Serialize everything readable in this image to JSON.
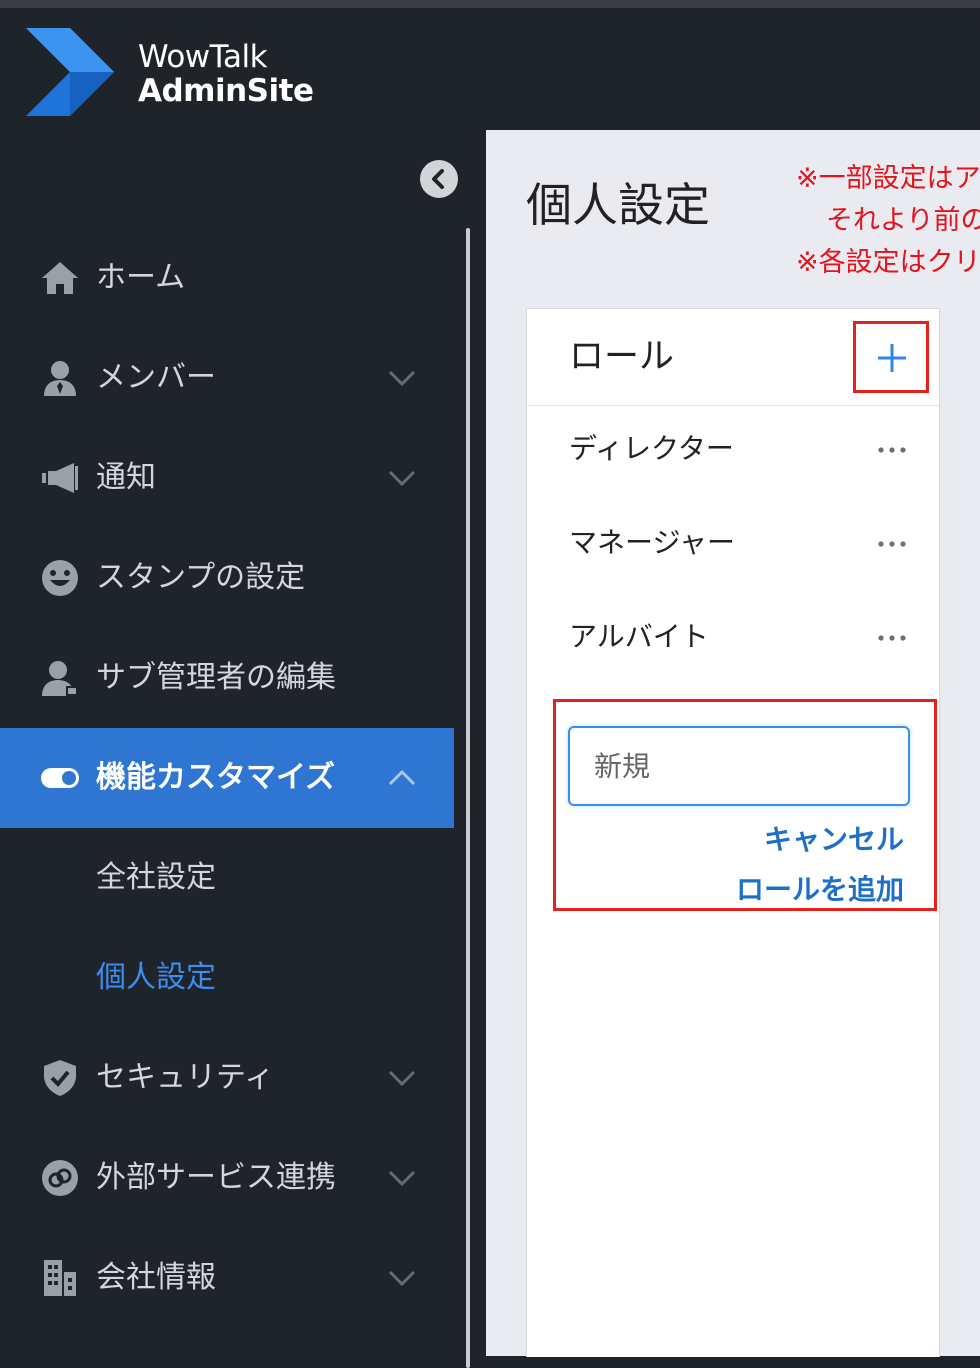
{
  "app": {
    "logo_line1": "WowTalk",
    "logo_line2": "AdminSite"
  },
  "colors": {
    "sidebar_bg": "#1f232a",
    "active_bg": "#2e76d2",
    "accent": "#3a8ef0",
    "highlight_red": "#e3221b",
    "notice_red": "#e6121c"
  },
  "sidebar": {
    "items": [
      {
        "label": "ホーム",
        "icon": "home-icon"
      },
      {
        "label": "メンバー",
        "icon": "member-icon",
        "expandable": true
      },
      {
        "label": "通知",
        "icon": "megaphone-icon",
        "expandable": true
      },
      {
        "label": "スタンプの設定",
        "icon": "smiley-icon"
      },
      {
        "label": "サブ管理者の編集",
        "icon": "sub-admin-icon"
      },
      {
        "label": "機能カスタマイズ",
        "icon": "toggle-icon",
        "expandable": true,
        "expanded": true,
        "active": true
      },
      {
        "label": "セキュリティ",
        "icon": "shield-icon",
        "expandable": true
      },
      {
        "label": "外部サービス連携",
        "icon": "link-icon",
        "expandable": true
      },
      {
        "label": "会社情報",
        "icon": "building-icon",
        "expandable": true
      }
    ],
    "subitems": [
      {
        "label": "全社設定"
      },
      {
        "label": "個人設定",
        "current": true
      }
    ]
  },
  "main": {
    "title": "個人設定",
    "notice_lines": [
      "※一部設定はア",
      "それより前の",
      "※各設定はクリ"
    ],
    "roles_panel": {
      "title": "ロール",
      "roles": [
        "ディレクター",
        "マネージャー",
        "アルバイト"
      ],
      "new_role": {
        "placeholder": "新規",
        "cancel_label": "キャンセル",
        "add_label": "ロールを追加"
      }
    }
  }
}
